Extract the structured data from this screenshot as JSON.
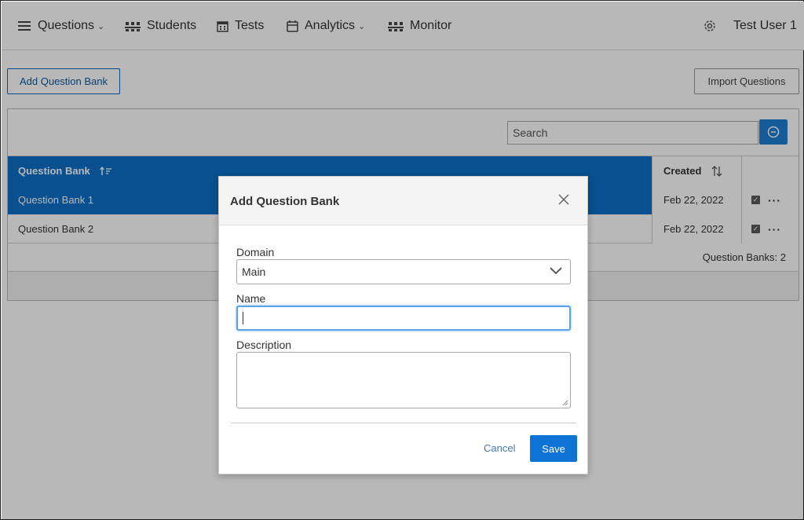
{
  "nav": {
    "items": [
      {
        "label": "Questions",
        "has_dropdown": true,
        "icon": "menu-lines-icon"
      },
      {
        "label": "Students",
        "has_dropdown": false,
        "icon": "students-icon"
      },
      {
        "label": "Tests",
        "has_dropdown": false,
        "icon": "tests-calendar-icon"
      },
      {
        "label": "Analytics",
        "has_dropdown": true,
        "icon": "calendar-icon"
      },
      {
        "label": "Monitor",
        "has_dropdown": false,
        "icon": "monitor-icon"
      }
    ],
    "user": "Test User 1",
    "settings_icon": "gear-icon"
  },
  "toolbar": {
    "add_label": "Add Question Bank",
    "import_label": "Import Questions"
  },
  "grid": {
    "search_placeholder": "Search",
    "columns": [
      {
        "label": "Question Bank",
        "sort_icon": "sort-asc-icon"
      },
      {
        "label": "Created",
        "sort_icon": "sort-both-icon"
      }
    ],
    "rows": [
      {
        "name": "Question Bank 1",
        "created": "Feb 22, 2022",
        "selected": true
      },
      {
        "name": "Question Bank 2",
        "created": "Feb 22, 2022",
        "selected": false
      }
    ],
    "count_text": "Question Banks: 2",
    "actions_label": "···"
  },
  "modal": {
    "title": "Add Question Bank",
    "domain_label": "Domain",
    "domain_value": "Main",
    "name_label": "Name",
    "name_value": "",
    "description_label": "Description",
    "description_value": "",
    "cancel_label": "Cancel",
    "save_label": "Save"
  },
  "colors": {
    "primary": "#0d6fc8",
    "save": "#0d74d6",
    "overlay": "rgba(0,0,0,0.28)"
  }
}
